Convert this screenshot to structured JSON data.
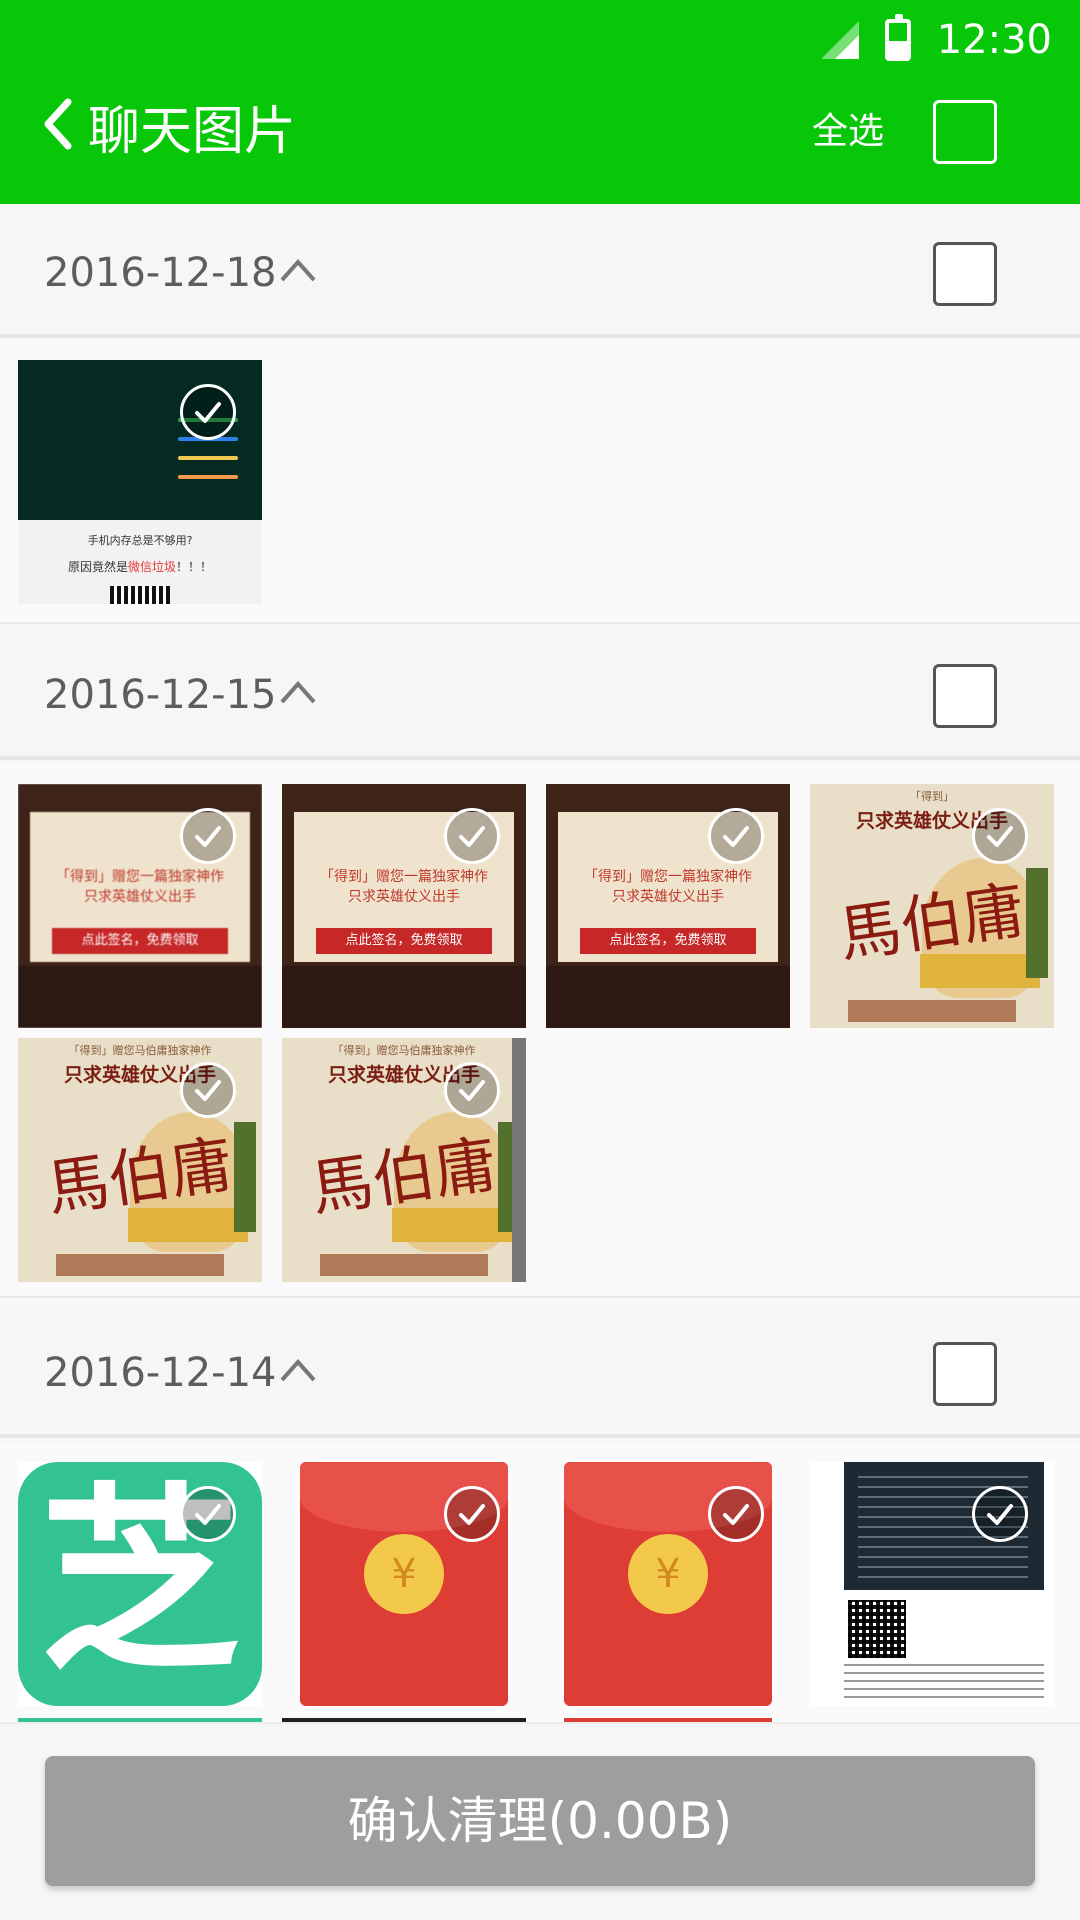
{
  "status_bar": {
    "time": "12:30"
  },
  "header": {
    "title": "聊天图片",
    "select_all_label": "全选",
    "accent_color": "#08c708"
  },
  "groups": [
    {
      "date": "2016-12-18",
      "images": [
        {
          "kind": "screenshot",
          "text_line1": "手机内存总是不够用?",
          "text_line2": "原因竟然是",
          "text_highlight": "微信垃圾",
          "text_suffix": "！！！"
        }
      ]
    },
    {
      "date": "2016-12-15",
      "images": [
        {
          "kind": "card",
          "text_line1": "「得到」赠您一篇独家神作",
          "text_line2": "只求英雄仗义出手",
          "button": "点此签名，免费领取"
        },
        {
          "kind": "card",
          "text_line1": "「得到」赠您一篇独家神作",
          "text_line2": "只求英雄仗义出手",
          "button": "点此签名，免费领取"
        },
        {
          "kind": "card",
          "text_line1": "「得到」赠您一篇独家神作",
          "text_line2": "只求英雄仗义出手",
          "button": "点此签名，免费领取"
        },
        {
          "kind": "poster",
          "top_small": "「得到」",
          "top_large": "只求英雄仗义出手",
          "brush": "馬伯庸"
        },
        {
          "kind": "poster",
          "top_small": "「得到」赠您马伯庸独家神作",
          "top_large": "只求英雄仗义出手",
          "brush": "馬伯庸"
        },
        {
          "kind": "poster",
          "top_small": "「得到」赠您马伯庸独家神作",
          "top_large": "只求英雄仗义出手",
          "brush": "馬伯庸"
        }
      ]
    },
    {
      "date": "2016-12-14",
      "images": [
        {
          "kind": "app-icon",
          "glyph": "芝"
        },
        {
          "kind": "red-envelope",
          "coin": "¥"
        },
        {
          "kind": "red-envelope",
          "coin": "¥"
        },
        {
          "kind": "document"
        }
      ]
    }
  ],
  "footer": {
    "confirm_label": "确认清理(0.00B)"
  }
}
